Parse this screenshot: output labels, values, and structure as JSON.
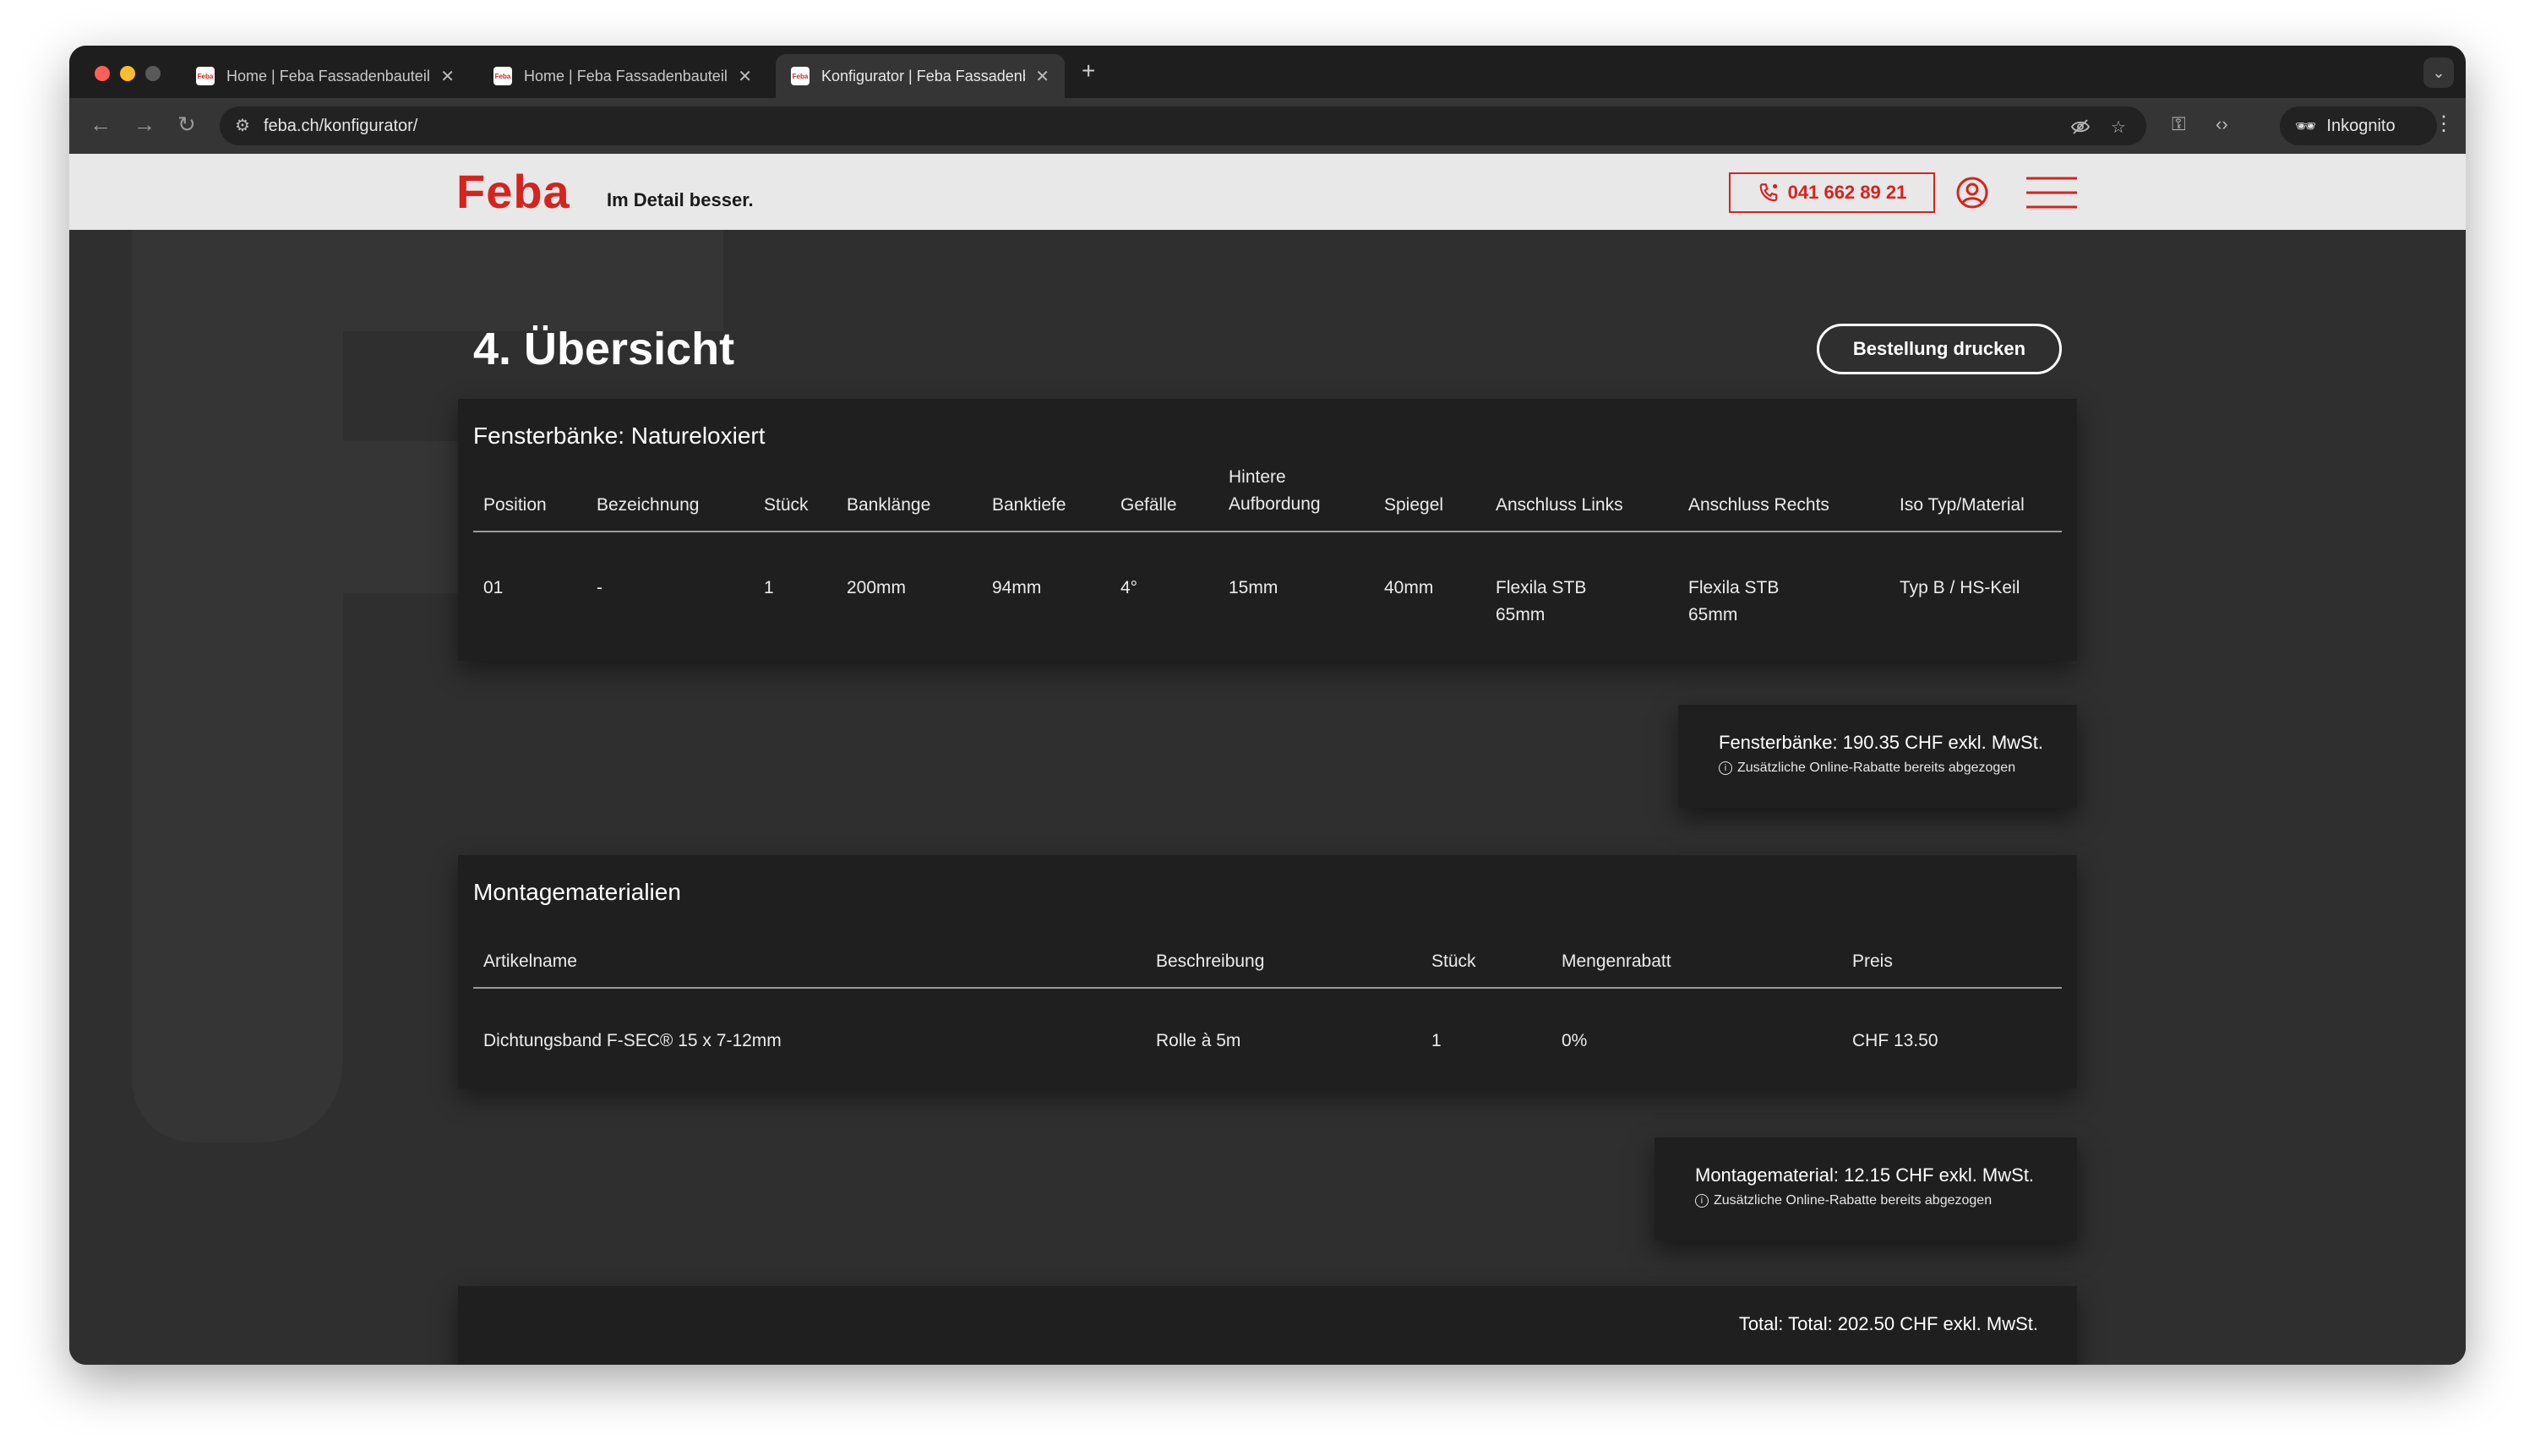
{
  "browser": {
    "tabs": [
      {
        "title": "Home | Feba Fassadenbauteile",
        "active": false
      },
      {
        "title": "Home | Feba Fassadenbauteile",
        "active": false
      },
      {
        "title": "Konfigurator | Feba Fassadenbauteile",
        "active": true
      }
    ],
    "new_tab": "+",
    "url": "feba.ch/konfigurator/",
    "incognito_label": "Inkognito"
  },
  "header": {
    "logo": "Feba",
    "tagline": "Im Detail besser.",
    "phone": "041 662 89 21",
    "brand_color": "#d6231f"
  },
  "page": {
    "title": "4. Übersicht",
    "print_button": "Bestellung drucken"
  },
  "sills": {
    "title": "Fensterbänke: Natureloxiert",
    "columns": [
      "Position",
      "Bezeichnung",
      "Stück",
      "Banklänge",
      "Banktiefe",
      "Gefälle",
      "Hintere\nAufbordung",
      "Spiegel",
      "Anschluss Links",
      "Anschluss Rechts",
      "Iso Typ/Material"
    ],
    "rows": [
      [
        "01",
        "-",
        "1",
        "200mm",
        "94mm",
        "4°",
        "15mm",
        "40mm",
        "Flexila STB\n65mm",
        "Flexila STB\n65mm",
        "Typ B / HS-Keil"
      ]
    ],
    "summary": "Fensterbänke: 190.35 CHF exkl. MwSt.",
    "note": "Zusätzliche Online-Rabatte bereits abgezogen"
  },
  "mounting": {
    "title": "Montagematerialien",
    "columns": [
      "Artikelname",
      "Beschreibung",
      "Stück",
      "Mengenrabatt",
      "Preis"
    ],
    "rows": [
      [
        "Dichtungsband F-SEC® 15 x 7-12mm",
        "Rolle à 5m",
        "1",
        "0%",
        "CHF 13.50"
      ]
    ],
    "summary": "Montagematerial: 12.15 CHF exkl. MwSt.",
    "note": "Zusätzliche Online-Rabatte bereits abgezogen"
  },
  "total": "Total: Total: 202.50 CHF exkl. MwSt."
}
